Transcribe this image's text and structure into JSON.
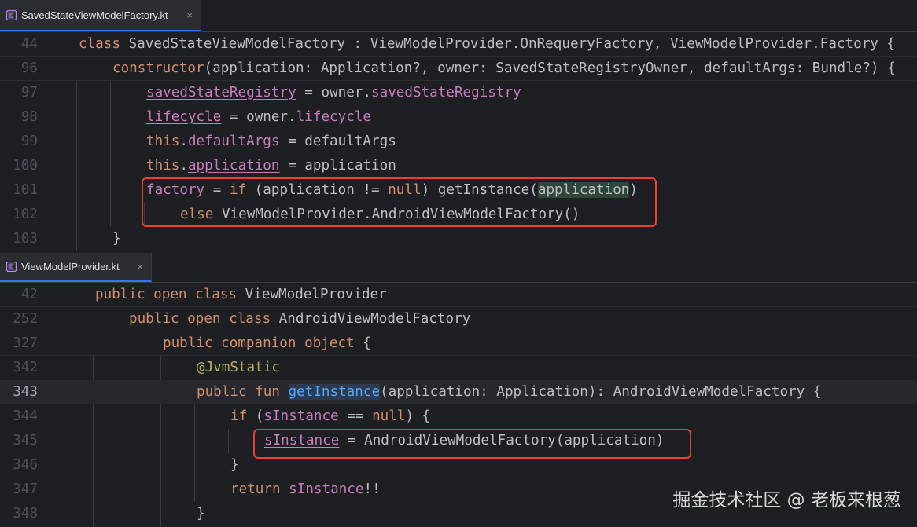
{
  "tabs": [
    {
      "label": "SavedStateViewModelFactory.kt",
      "close": "×"
    },
    {
      "label": "ViewModelProvider.kt",
      "close": "×"
    }
  ],
  "editor1": {
    "lines": [
      {
        "num": "44",
        "tokens": [
          {
            "t": "class ",
            "c": "kw"
          },
          {
            "t": "SavedStateViewModelFactory : ViewModelProvider.OnRequeryFactory, ViewModelProvider.Factory {",
            "c": ""
          }
        ]
      },
      {
        "num": "96",
        "tokens": [
          {
            "t": "constructor",
            "c": "kw"
          },
          {
            "t": "(application: Application?, owner: SavedStateRegistryOwner, defaultArgs: Bundle?) {",
            "c": ""
          }
        ]
      },
      {
        "num": "97",
        "tokens": [
          {
            "t": "savedStateRegistry",
            "c": "prop-u"
          },
          {
            "t": " = owner.",
            "c": ""
          },
          {
            "t": "savedStateRegistry",
            "c": "prop"
          }
        ]
      },
      {
        "num": "98",
        "tokens": [
          {
            "t": "lifecycle",
            "c": "prop-u"
          },
          {
            "t": " = owner.",
            "c": ""
          },
          {
            "t": "lifecycle",
            "c": "prop"
          }
        ]
      },
      {
        "num": "99",
        "tokens": [
          {
            "t": "this",
            "c": "kw"
          },
          {
            "t": ".",
            "c": ""
          },
          {
            "t": "defaultArgs",
            "c": "prop-u"
          },
          {
            "t": " = defaultArgs",
            "c": ""
          }
        ]
      },
      {
        "num": "100",
        "tokens": [
          {
            "t": "this",
            "c": "kw"
          },
          {
            "t": ".",
            "c": ""
          },
          {
            "t": "application",
            "c": "prop-u"
          },
          {
            "t": " = application",
            "c": ""
          }
        ]
      },
      {
        "num": "101",
        "tokens": [
          {
            "t": "factory",
            "c": "prop"
          },
          {
            "t": " = ",
            "c": ""
          },
          {
            "t": "if",
            "c": "kw"
          },
          {
            "t": " (application != ",
            "c": ""
          },
          {
            "t": "null",
            "c": "kw"
          },
          {
            "t": ") getInstance(",
            "c": ""
          },
          {
            "t": "application",
            "c": "hl-usage"
          },
          {
            "t": ")",
            "c": ""
          }
        ]
      },
      {
        "num": "102",
        "tokens": [
          {
            "t": "else",
            "c": "kw"
          },
          {
            "t": " ViewModelProvider.AndroidViewModelFactory()",
            "c": ""
          }
        ]
      },
      {
        "num": "103",
        "tokens": [
          {
            "t": "}",
            "c": ""
          }
        ]
      }
    ]
  },
  "editor2": {
    "lines": [
      {
        "num": "42",
        "tokens": [
          {
            "t": "public open class ",
            "c": "kw"
          },
          {
            "t": "ViewModelProvider",
            "c": ""
          }
        ]
      },
      {
        "num": "252",
        "tokens": [
          {
            "t": "public open class ",
            "c": "kw"
          },
          {
            "t": "AndroidViewModelFactory",
            "c": ""
          }
        ]
      },
      {
        "num": "327",
        "tokens": [
          {
            "t": "public companion object ",
            "c": "kw"
          },
          {
            "t": "{",
            "c": ""
          }
        ]
      },
      {
        "num": "342",
        "tokens": [
          {
            "t": "@JvmStatic",
            "c": "ann"
          }
        ]
      },
      {
        "num": "343",
        "tokens": [
          {
            "t": "public fun ",
            "c": "kw"
          },
          {
            "t": "getInstance",
            "c": "fn hl-def"
          },
          {
            "t": "(application: Application): AndroidViewModelFactory {",
            "c": ""
          }
        ]
      },
      {
        "num": "344",
        "tokens": [
          {
            "t": "if",
            "c": "kw"
          },
          {
            "t": " (",
            "c": ""
          },
          {
            "t": "sInstance",
            "c": "prop-u"
          },
          {
            "t": " == ",
            "c": ""
          },
          {
            "t": "null",
            "c": "kw"
          },
          {
            "t": ") {",
            "c": ""
          }
        ]
      },
      {
        "num": "345",
        "tokens": [
          {
            "t": "sInstance",
            "c": "prop-u"
          },
          {
            "t": " = AndroidViewModelFactory(application)",
            "c": ""
          }
        ]
      },
      {
        "num": "346",
        "tokens": [
          {
            "t": "}",
            "c": ""
          }
        ]
      },
      {
        "num": "347",
        "tokens": [
          {
            "t": "return ",
            "c": "kw"
          },
          {
            "t": "sInstance",
            "c": "prop-u"
          },
          {
            "t": "!!",
            "c": ""
          }
        ]
      },
      {
        "num": "348",
        "tokens": [
          {
            "t": "}",
            "c": ""
          }
        ]
      }
    ]
  },
  "watermark": "掘金技术社区 @ 老板来根葱",
  "colors": {
    "background": "#1e1f22",
    "keyword": "#cf8e6d",
    "property": "#c77dbb",
    "function": "#56a8f5",
    "annotation": "#b3ae60",
    "highlight_box": "#e8422f",
    "tab_accent": "#3574f0"
  },
  "icons": {
    "file_type": "kotlin-file-icon"
  }
}
